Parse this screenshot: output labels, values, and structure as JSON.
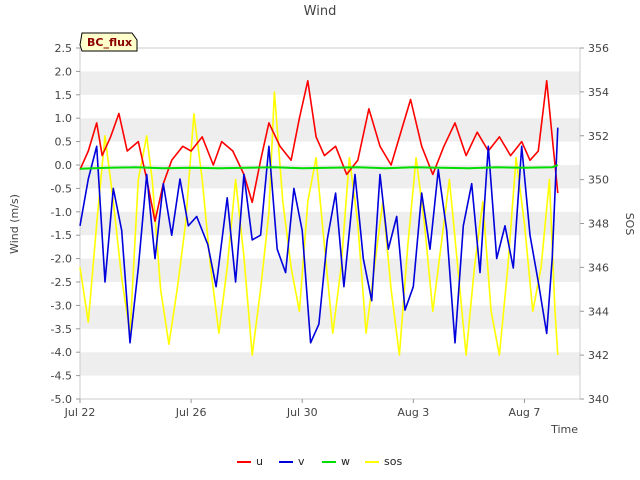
{
  "chart_data": {
    "type": "line",
    "title": "Wind",
    "xlabel": "Time",
    "ylabel": "Wind (m/s)",
    "y2label": "SOS",
    "badge": "BC_flux",
    "xlim_days": [
      0,
      18
    ],
    "x_ticks": [
      {
        "day": 0,
        "label": "Jul 22"
      },
      {
        "day": 4,
        "label": "Jul 26"
      },
      {
        "day": 8,
        "label": "Jul 30"
      },
      {
        "day": 12,
        "label": "Aug 3"
      },
      {
        "day": 16,
        "label": "Aug 7"
      }
    ],
    "ylim": [
      -5.0,
      2.5
    ],
    "y_ticks": [
      "-5.0",
      "-4.5",
      "-4.0",
      "-3.5",
      "-3.0",
      "-2.5",
      "-2.0",
      "-1.5",
      "-1.0",
      "-0.5",
      "0.0",
      "0.5",
      "1.0",
      "1.5",
      "2.0",
      "2.5"
    ],
    "y2lim": [
      340,
      356
    ],
    "y2_ticks": [
      "340",
      "342",
      "344",
      "346",
      "348",
      "350",
      "352",
      "354",
      "356"
    ],
    "grid": "horizontal bands",
    "legend_position": "bottom",
    "series": [
      {
        "name": "u",
        "axis": "left",
        "color": "#ff0000",
        "points": [
          [
            0,
            -0.1
          ],
          [
            0.3,
            0.3
          ],
          [
            0.6,
            0.9
          ],
          [
            0.8,
            0.2
          ],
          [
            1.1,
            0.6
          ],
          [
            1.4,
            1.1
          ],
          [
            1.7,
            0.3
          ],
          [
            2.1,
            0.5
          ],
          [
            2.4,
            -0.3
          ],
          [
            2.7,
            -1.2
          ],
          [
            3.0,
            -0.4
          ],
          [
            3.3,
            0.1
          ],
          [
            3.7,
            0.4
          ],
          [
            4.0,
            0.3
          ],
          [
            4.4,
            0.6
          ],
          [
            4.8,
            0.0
          ],
          [
            5.1,
            0.5
          ],
          [
            5.5,
            0.3
          ],
          [
            5.9,
            -0.2
          ],
          [
            6.2,
            -0.8
          ],
          [
            6.5,
            0.1
          ],
          [
            6.8,
            0.9
          ],
          [
            7.2,
            0.4
          ],
          [
            7.6,
            0.1
          ],
          [
            7.9,
            1.0
          ],
          [
            8.2,
            1.8
          ],
          [
            8.5,
            0.6
          ],
          [
            8.8,
            0.2
          ],
          [
            9.2,
            0.4
          ],
          [
            9.6,
            -0.2
          ],
          [
            10.0,
            0.1
          ],
          [
            10.4,
            1.2
          ],
          [
            10.8,
            0.4
          ],
          [
            11.2,
            0.0
          ],
          [
            11.6,
            0.8
          ],
          [
            11.9,
            1.4
          ],
          [
            12.3,
            0.4
          ],
          [
            12.7,
            -0.2
          ],
          [
            13.1,
            0.4
          ],
          [
            13.5,
            0.9
          ],
          [
            13.9,
            0.2
          ],
          [
            14.3,
            0.7
          ],
          [
            14.7,
            0.3
          ],
          [
            15.1,
            0.6
          ],
          [
            15.5,
            0.2
          ],
          [
            15.9,
            0.5
          ],
          [
            16.2,
            0.1
          ],
          [
            16.5,
            0.3
          ],
          [
            16.8,
            1.8
          ],
          [
            17.0,
            0.6
          ],
          [
            17.2,
            -0.6
          ]
        ]
      },
      {
        "name": "v",
        "axis": "left",
        "color": "#0000dd",
        "points": [
          [
            0,
            -1.3
          ],
          [
            0.3,
            -0.3
          ],
          [
            0.6,
            0.4
          ],
          [
            0.9,
            -2.5
          ],
          [
            1.2,
            -0.5
          ],
          [
            1.5,
            -1.4
          ],
          [
            1.8,
            -3.8
          ],
          [
            2.1,
            -2.2
          ],
          [
            2.4,
            -0.2
          ],
          [
            2.7,
            -2.0
          ],
          [
            3.0,
            -0.4
          ],
          [
            3.3,
            -1.5
          ],
          [
            3.6,
            -0.3
          ],
          [
            3.9,
            -1.3
          ],
          [
            4.2,
            -1.1
          ],
          [
            4.6,
            -1.7
          ],
          [
            4.9,
            -2.6
          ],
          [
            5.3,
            -0.7
          ],
          [
            5.6,
            -2.5
          ],
          [
            5.9,
            -0.2
          ],
          [
            6.2,
            -1.6
          ],
          [
            6.5,
            -1.5
          ],
          [
            6.8,
            0.4
          ],
          [
            7.1,
            -1.8
          ],
          [
            7.4,
            -2.3
          ],
          [
            7.7,
            -0.5
          ],
          [
            8.0,
            -1.4
          ],
          [
            8.3,
            -3.8
          ],
          [
            8.6,
            -3.4
          ],
          [
            8.9,
            -1.6
          ],
          [
            9.2,
            -0.6
          ],
          [
            9.5,
            -2.6
          ],
          [
            9.9,
            -0.2
          ],
          [
            10.2,
            -2.0
          ],
          [
            10.5,
            -2.9
          ],
          [
            10.8,
            -0.2
          ],
          [
            11.1,
            -1.8
          ],
          [
            11.4,
            -1.1
          ],
          [
            11.7,
            -3.1
          ],
          [
            12.0,
            -2.6
          ],
          [
            12.3,
            -0.6
          ],
          [
            12.6,
            -1.8
          ],
          [
            12.9,
            -0.1
          ],
          [
            13.2,
            -1.4
          ],
          [
            13.5,
            -3.8
          ],
          [
            13.8,
            -1.3
          ],
          [
            14.1,
            -0.4
          ],
          [
            14.4,
            -2.3
          ],
          [
            14.7,
            0.4
          ],
          [
            15.0,
            -2.0
          ],
          [
            15.3,
            -1.3
          ],
          [
            15.6,
            -2.2
          ],
          [
            15.9,
            0.4
          ],
          [
            16.2,
            -1.5
          ],
          [
            16.5,
            -2.5
          ],
          [
            16.8,
            -3.6
          ],
          [
            17.0,
            -2.0
          ],
          [
            17.2,
            0.8
          ]
        ]
      },
      {
        "name": "w",
        "axis": "left",
        "color": "#00dd00",
        "points": [
          [
            0,
            -0.08
          ],
          [
            1,
            -0.06
          ],
          [
            2,
            -0.05
          ],
          [
            3,
            -0.07
          ],
          [
            4,
            -0.06
          ],
          [
            5,
            -0.07
          ],
          [
            6,
            -0.06
          ],
          [
            7,
            -0.05
          ],
          [
            8,
            -0.07
          ],
          [
            9,
            -0.06
          ],
          [
            10,
            -0.05
          ],
          [
            11,
            -0.07
          ],
          [
            12,
            -0.05
          ],
          [
            13,
            -0.06
          ],
          [
            14,
            -0.07
          ],
          [
            15,
            -0.05
          ],
          [
            16,
            -0.06
          ],
          [
            17,
            -0.05
          ],
          [
            17.2,
            0.0
          ]
        ]
      },
      {
        "name": "sos",
        "axis": "right",
        "color": "#ffff00",
        "points": [
          [
            0,
            346
          ],
          [
            0.3,
            343.5
          ],
          [
            0.6,
            348
          ],
          [
            0.9,
            352
          ],
          [
            1.2,
            349
          ],
          [
            1.5,
            345.5
          ],
          [
            1.8,
            343
          ],
          [
            2.1,
            350
          ],
          [
            2.4,
            352
          ],
          [
            2.6,
            350
          ],
          [
            2.9,
            345
          ],
          [
            3.2,
            342.5
          ],
          [
            3.5,
            345
          ],
          [
            3.8,
            348
          ],
          [
            4.1,
            353
          ],
          [
            4.4,
            350
          ],
          [
            4.7,
            346
          ],
          [
            5.0,
            343
          ],
          [
            5.3,
            346
          ],
          [
            5.6,
            350
          ],
          [
            5.9,
            346.5
          ],
          [
            6.2,
            342
          ],
          [
            6.5,
            345
          ],
          [
            6.8,
            348.5
          ],
          [
            7.0,
            354
          ],
          [
            7.3,
            349
          ],
          [
            7.6,
            346
          ],
          [
            7.9,
            344
          ],
          [
            8.2,
            349
          ],
          [
            8.5,
            351
          ],
          [
            8.8,
            347
          ],
          [
            9.1,
            343
          ],
          [
            9.4,
            346
          ],
          [
            9.7,
            351
          ],
          [
            10.0,
            348
          ],
          [
            10.3,
            343
          ],
          [
            10.6,
            346
          ],
          [
            10.9,
            349
          ],
          [
            11.2,
            345
          ],
          [
            11.5,
            342
          ],
          [
            11.8,
            347
          ],
          [
            12.1,
            351
          ],
          [
            12.4,
            348
          ],
          [
            12.7,
            344
          ],
          [
            13.0,
            347
          ],
          [
            13.3,
            350
          ],
          [
            13.6,
            346
          ],
          [
            13.9,
            342
          ],
          [
            14.2,
            346
          ],
          [
            14.5,
            349
          ],
          [
            14.8,
            344
          ],
          [
            15.1,
            342
          ],
          [
            15.4,
            346
          ],
          [
            15.7,
            351
          ],
          [
            16.0,
            348
          ],
          [
            16.3,
            344
          ],
          [
            16.6,
            346
          ],
          [
            16.9,
            350
          ],
          [
            17.1,
            344
          ],
          [
            17.2,
            342
          ]
        ]
      }
    ]
  }
}
